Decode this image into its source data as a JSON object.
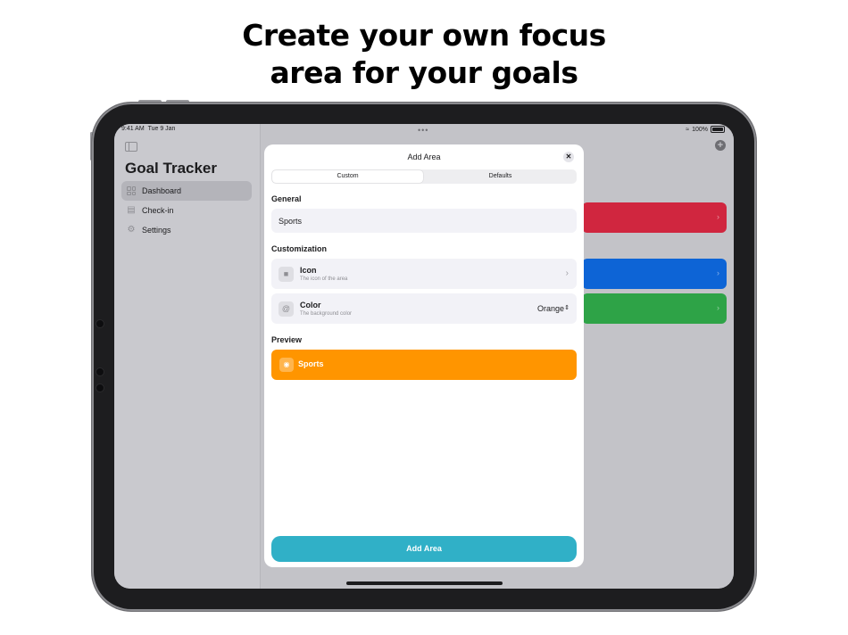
{
  "headline": {
    "line1": "Create your own focus",
    "line2": "area for your goals"
  },
  "status_bar": {
    "time": "9:41 AM",
    "date": "Tue 9 Jan",
    "battery": "100%",
    "icons": [
      "wifi-icon",
      "battery-icon"
    ]
  },
  "sidebar": {
    "toggle_icon": "sidebar-icon",
    "title": "Goal Tracker",
    "items": [
      {
        "label": "Dashboard",
        "icon": "grid-icon",
        "selected": true
      },
      {
        "label": "Check-in",
        "icon": "calendar-icon",
        "selected": false
      },
      {
        "label": "Settings",
        "icon": "gear-icon",
        "selected": false
      }
    ]
  },
  "detail": {
    "add_icon": "plus-icon",
    "background_cards": [
      {
        "color": "#d0263f"
      },
      {
        "color": "#0d64d6"
      },
      {
        "color": "#2ea347"
      }
    ]
  },
  "modal": {
    "title": "Add Area",
    "close_icon": "close-icon",
    "segments": [
      {
        "label": "Custom",
        "active": true
      },
      {
        "label": "Defaults",
        "active": false
      }
    ],
    "general": {
      "header": "General",
      "name_value": "Sports"
    },
    "customization": {
      "header": "Customization",
      "icon_row": {
        "title": "Icon",
        "subtitle": "The icon of the area",
        "icon": "square-icon"
      },
      "color_row": {
        "title": "Color",
        "subtitle": "The background color",
        "value": "Orange",
        "icon": "palette-icon"
      }
    },
    "preview": {
      "header": "Preview",
      "label": "Sports",
      "color": "#ff9500",
      "icon": "sports-ball-icon"
    },
    "primary_button": "Add Area"
  },
  "colors": {
    "accent": "#30b0c7",
    "orange": "#ff9500"
  }
}
